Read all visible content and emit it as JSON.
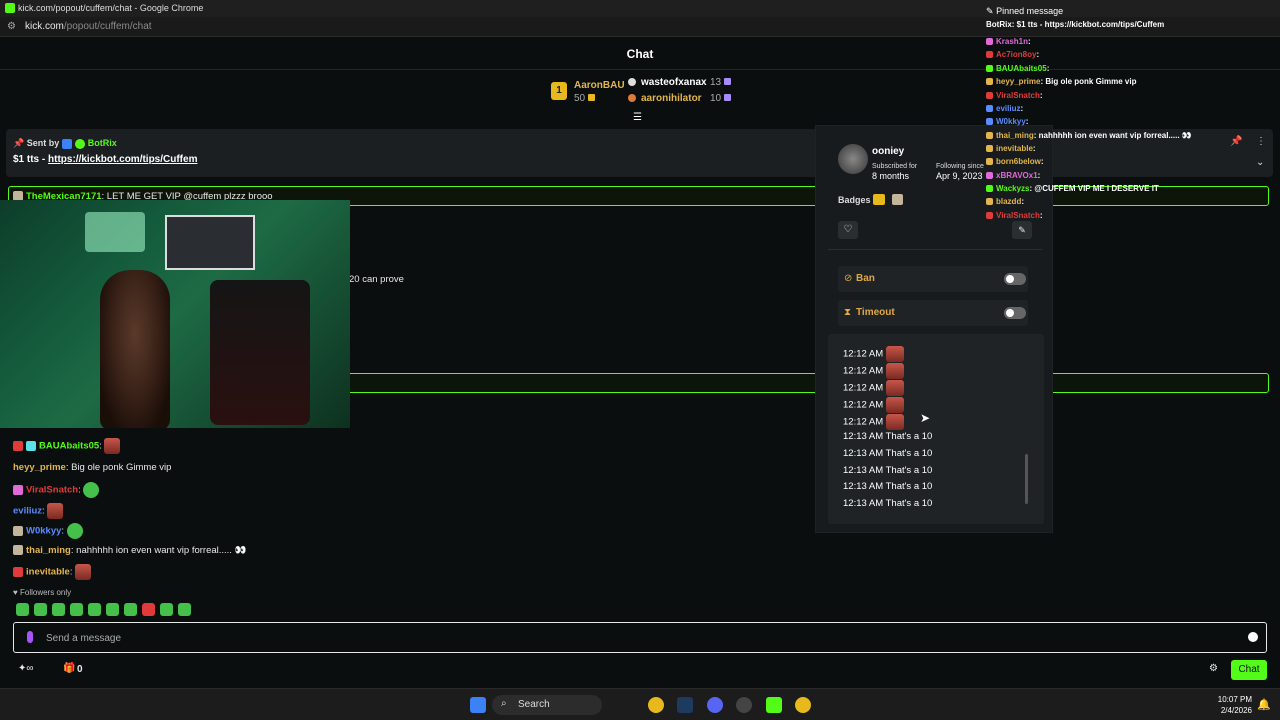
{
  "browser": {
    "title": "kick.com/popout/cuffem/chat - Google Chrome",
    "url_host": "kick.com",
    "url_path": "/popout/cuffem/chat"
  },
  "chat_header": {
    "title": "Chat"
  },
  "leaderboard": {
    "first": {
      "rank": "1",
      "name": "AaronBAU",
      "amount": "50"
    },
    "second": {
      "name": "wasteofxanax",
      "amount": "13"
    },
    "third": {
      "name": "aaronihilator",
      "amount": "10"
    }
  },
  "pinned": {
    "sent_by_label": "Sent by",
    "sender": "BotRix",
    "message_text": "$1 tts - ",
    "message_link": "https://kickbot.com/tips/Cuffem"
  },
  "messages": {
    "m1": {
      "user": "TheMexican7171",
      "text": "LET ME GET VIP @cuffem plzzz brooo"
    },
    "m2": {
      "text": "20 can prove"
    },
    "m3": {
      "user": "BAUAbaits05",
      "sep": ":"
    },
    "m4": {
      "user": "heyy_prime",
      "text": "Big ole ponk Gimme vip"
    },
    "m5": {
      "user": "ViralSnatch",
      "sep": ":"
    },
    "m6": {
      "user": "eviliuz",
      "sep": ":"
    },
    "m7": {
      "user": "W0kkyy",
      "sep": ":"
    },
    "m8": {
      "user": "thai_ming",
      "text": "nahhhhh ion even want vip forreal..... 👀"
    },
    "m9": {
      "user": "inevitable",
      "sep": ":"
    }
  },
  "followers_only": "Followers only",
  "input": {
    "placeholder": "Send a message"
  },
  "bottom": {
    "count": "0",
    "chat_button": "Chat"
  },
  "user_card": {
    "username": "ooniey",
    "subscribed_label": "Subscribed for",
    "subscribed_value": "8 months",
    "following_label": "Following since",
    "following_value": "Apr 9, 2023",
    "badges_label": "Badges",
    "ban_label": "Ban",
    "timeout_label": "Timeout",
    "history": [
      {
        "time": "12:12 AM",
        "text": ""
      },
      {
        "time": "12:12 AM",
        "text": ""
      },
      {
        "time": "12:12 AM",
        "text": ""
      },
      {
        "time": "12:12 AM",
        "text": ""
      },
      {
        "time": "12:12 AM",
        "text": ""
      },
      {
        "time": "12:13 AM",
        "text": "That's a 10"
      },
      {
        "time": "12:13 AM",
        "text": "That's a 10"
      },
      {
        "time": "12:13 AM",
        "text": "That's a 10"
      },
      {
        "time": "12:13 AM",
        "text": "That's a 10"
      },
      {
        "time": "12:13 AM",
        "text": "That's a 10"
      }
    ]
  },
  "overlay": {
    "pinned_label": "Pinned message",
    "pinned_text": "BotRix: $1 tts - https://kickbot.com/tips/Cuffem",
    "lines": [
      {
        "user": "Krash1n",
        "text": ":",
        "color": "#e06ad8"
      },
      {
        "user": "Ac7ion8oy",
        "text": ":",
        "color": "#e03a3a"
      },
      {
        "user": "BAUAbaits05",
        "text": ":",
        "color": "#53fc18"
      },
      {
        "user": "heyy_prime",
        "text": ": Big ole ponk Gimme vip",
        "color": "#e2b64c"
      },
      {
        "user": "ViralSnatch",
        "text": ":",
        "color": "#e03a3a"
      },
      {
        "user": "eviliuz",
        "text": ":",
        "color": "#5a8cff"
      },
      {
        "user": "W0kkyy",
        "text": ":",
        "color": "#5a8cff"
      },
      {
        "user": "thai_ming",
        "text": ": nahhhhh ion even want vip forreal..... 👀",
        "color": "#e2b64c"
      },
      {
        "user": "inevitable",
        "text": ":",
        "color": "#e2b64c"
      },
      {
        "user": "born6below",
        "text": ":",
        "color": "#e2b64c"
      },
      {
        "user": "xBRAVOx1",
        "text": ":",
        "color": "#e06ad8"
      },
      {
        "user": "Wackyzs",
        "text": ": @CUFFEM VIP ME I DESERVE IT",
        "color": "#53fc18"
      },
      {
        "user": "blazdd",
        "text": ":",
        "color": "#e2b64c"
      },
      {
        "user": "ViralSnatch",
        "text": ":",
        "color": "#e03a3a"
      }
    ]
  },
  "taskbar": {
    "search": "Search",
    "time": "10:07 PM",
    "date": "2/4/2026"
  },
  "colors": {
    "accent": "#53fc18",
    "gold": "#e2b64c",
    "red_name": "#e03a3a",
    "blue_name": "#5a8cff",
    "purple": "#a855f7"
  }
}
